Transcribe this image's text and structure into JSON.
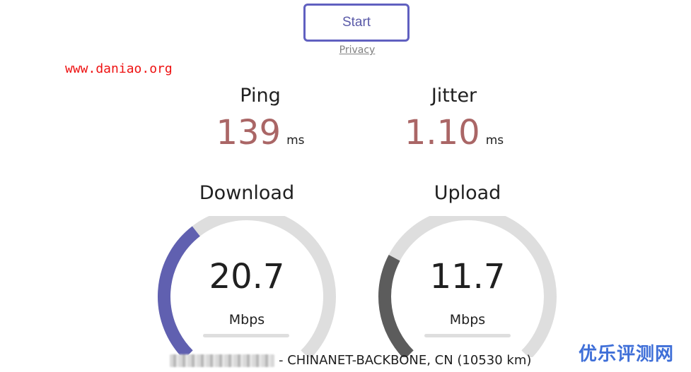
{
  "start_button": {
    "label": "Start"
  },
  "privacy_link": {
    "label": "Privacy"
  },
  "watermark_url": "www.daniao.org",
  "ping": {
    "label": "Ping",
    "value": "139",
    "unit": "ms"
  },
  "jitter": {
    "label": "Jitter",
    "value": "1.10",
    "unit": "ms"
  },
  "download": {
    "label": "Download",
    "value": "20.7",
    "unit": "Mbps",
    "fill_fraction": 0.36
  },
  "upload": {
    "label": "Upload",
    "value": "11.7",
    "unit": "Mbps",
    "fill_fraction": 0.27
  },
  "server": {
    "text": "- CHINANET-BACKBONE, CN (10530 km)"
  },
  "site_logo": "优乐评测网",
  "colors": {
    "download_arc": "#6060b0",
    "upload_arc": "#5c5c5c",
    "track_arc": "#dedede",
    "stat_value": "#aa6666",
    "start_border": "#6060c0",
    "watermark": "#ee1111",
    "logo": "#3f6fd8"
  }
}
